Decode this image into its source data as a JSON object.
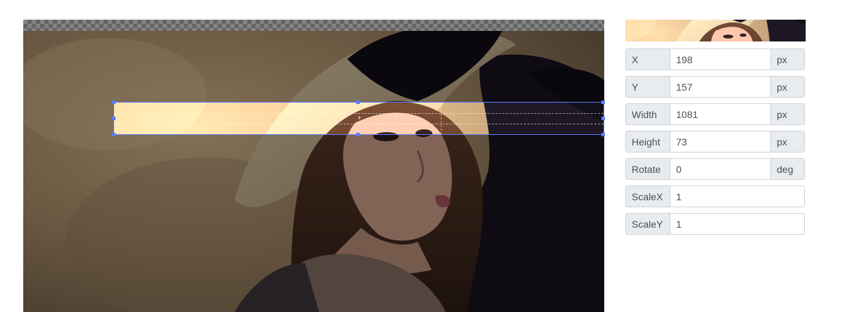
{
  "editor": {
    "image_subject": "portrait-photo"
  },
  "form": {
    "rows": [
      {
        "label": "X",
        "value": "198",
        "unit": "px"
      },
      {
        "label": "Y",
        "value": "157",
        "unit": "px"
      },
      {
        "label": "Width",
        "value": "1081",
        "unit": "px"
      },
      {
        "label": "Height",
        "value": "73",
        "unit": "px"
      },
      {
        "label": "Rotate",
        "value": "0",
        "unit": "deg"
      },
      {
        "label": "ScaleX",
        "value": "1"
      },
      {
        "label": "ScaleY",
        "value": "1"
      }
    ]
  },
  "colors": {
    "crop_border": "#5a7bff",
    "addon_bg": "#e9ecef",
    "input_border": "#ced4da"
  }
}
